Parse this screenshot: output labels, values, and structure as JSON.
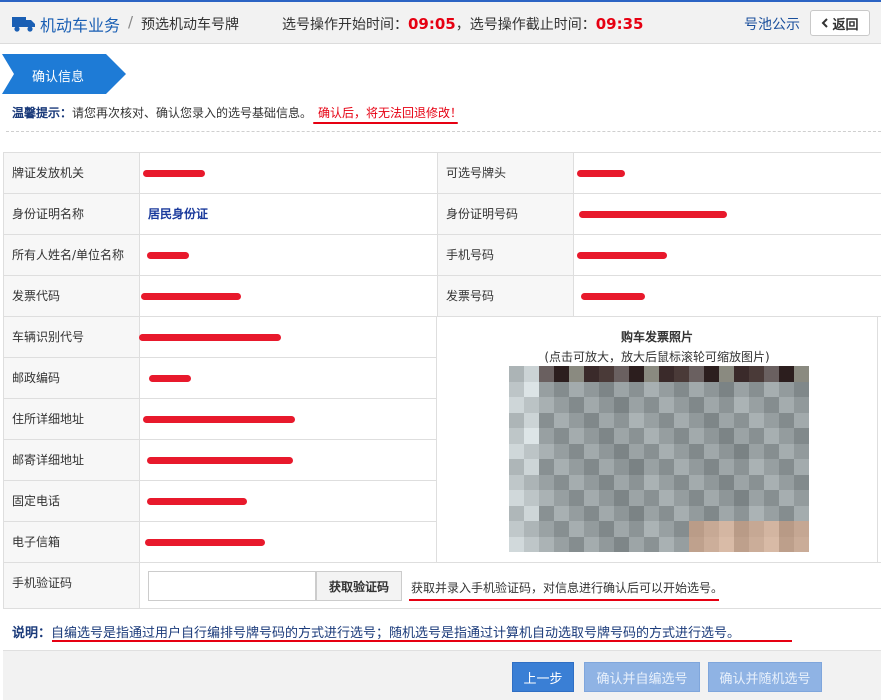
{
  "header": {
    "module": "机动车业务",
    "separator": "/",
    "page": "预选机动车号牌",
    "time_label_start": "选号操作开始时间：",
    "start_time": "09:05",
    "time_label_end": "，选号操作截止时间：",
    "end_time": "09:35",
    "pool_link": "号池公示",
    "back_label": "返回"
  },
  "step": {
    "label": "确认信息"
  },
  "tip": {
    "prefix": "温馨提示：",
    "text": "请您再次核对、确认您录入的选号基础信息。",
    "warning": "确认后，将无法回退修改！"
  },
  "fields": {
    "issuing_authority": {
      "label": "牌证发放机关",
      "value": ""
    },
    "plate_prefix": {
      "label": "可选号牌头",
      "value": ""
    },
    "id_type": {
      "label": "身份证明名称",
      "value": "居民身份证"
    },
    "id_number": {
      "label": "身份证明号码",
      "value": ""
    },
    "owner_name": {
      "label": "所有人姓名/单位名称",
      "value": ""
    },
    "phone": {
      "label": "手机号码",
      "value": ""
    },
    "invoice_code": {
      "label": "发票代码",
      "value": ""
    },
    "invoice_number": {
      "label": "发票号码",
      "value": ""
    },
    "vin": {
      "label": "车辆识别代号",
      "value": ""
    },
    "postal_code": {
      "label": "邮政编码",
      "value": ""
    },
    "address": {
      "label": "住所详细地址",
      "value": ""
    },
    "mailing_address": {
      "label": "邮寄详细地址",
      "value": ""
    },
    "landline": {
      "label": "固定电话",
      "value": ""
    },
    "email": {
      "label": "电子信箱",
      "value": ""
    },
    "sms_code": {
      "label": "手机验证码",
      "value": "",
      "button": "获取验证码",
      "hint": "获取并录入手机验证码，对信息进行确认后可以开始选号。"
    }
  },
  "photo": {
    "title": "购车发票照片",
    "subtitle": "(点击可放大，放大后鼠标滚轮可缩放图片)"
  },
  "note": {
    "prefix": "说明：",
    "text": "自编选号是指通过用户自行编排号牌号码的方式进行选号；随机选号是指通过计算机自动选取号牌号码的方式进行选号。"
  },
  "footer": {
    "prev": "上一步",
    "confirm_custom": "确认并自编选号",
    "confirm_random": "确认并随机选号"
  },
  "colors": {
    "accent": "#1a5fb4",
    "warning": "#e60012",
    "button": "#3a7fd5"
  }
}
